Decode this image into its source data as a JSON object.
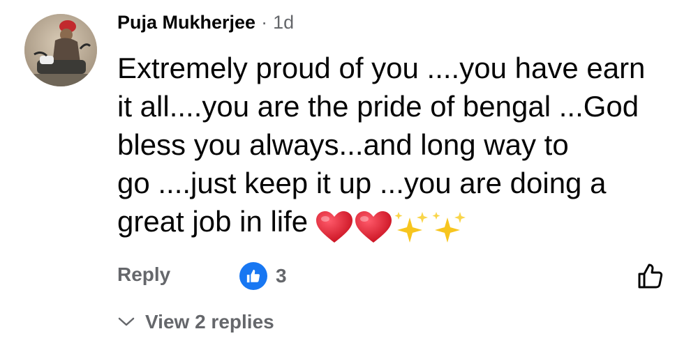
{
  "comment": {
    "author": "Puja Mukherjee",
    "separator": "·",
    "timestamp": "1d",
    "lines": [
      "Extremely proud of you ....you have earn",
      "it all....you are the pride of bengal ...God",
      "bless you always...and long way to",
      "go ....just keep it up ...you are doing a",
      "great job  in life"
    ],
    "emojis": [
      "red-heart",
      "red-heart",
      "sparkles",
      "sparkles"
    ]
  },
  "actions": {
    "reply_label": "Reply",
    "reaction_count": "3",
    "reaction_type": "like",
    "like_button_icon": "thumbs-up-outline-icon"
  },
  "replies": {
    "view_label": "View 2 replies"
  },
  "colors": {
    "text_primary": "#050505",
    "text_secondary": "#65676b",
    "like_blue": "#1877f2",
    "heart_red": "#e0182d",
    "sparkle_yellow": "#f7c51e"
  }
}
